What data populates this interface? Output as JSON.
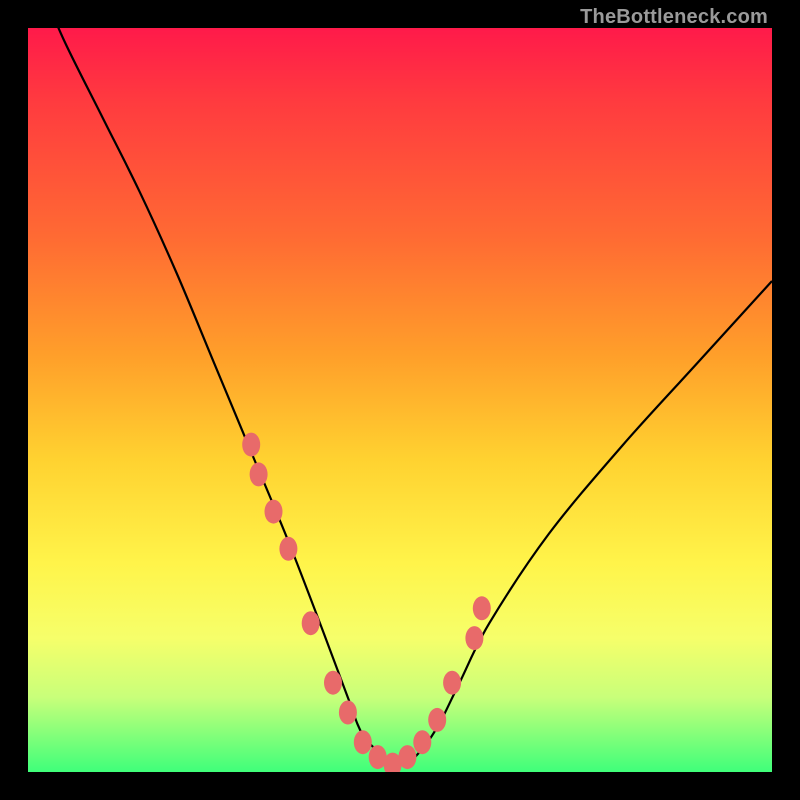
{
  "watermark": "TheBottleneck.com",
  "chart_data": {
    "type": "line",
    "title": "",
    "xlabel": "",
    "ylabel": "",
    "xlim": [
      0,
      100
    ],
    "ylim": [
      0,
      100
    ],
    "series": [
      {
        "name": "bottleneck-curve",
        "x": [
          2,
          5,
          10,
          15,
          20,
          25,
          30,
          35,
          40,
          43,
          45,
          48,
          50,
          52,
          55,
          58,
          62,
          70,
          80,
          90,
          100
        ],
        "values": [
          105,
          98,
          88,
          78,
          67,
          55,
          43,
          31,
          18,
          10,
          5,
          2,
          1,
          2,
          6,
          12,
          20,
          32,
          44,
          55,
          66
        ]
      }
    ],
    "points": {
      "name": "highlighted-points",
      "x": [
        30,
        31,
        33,
        35,
        38,
        41,
        43,
        45,
        47,
        49,
        51,
        53,
        55,
        57,
        60,
        61
      ],
      "values": [
        44,
        40,
        35,
        30,
        20,
        12,
        8,
        4,
        2,
        1,
        2,
        4,
        7,
        12,
        18,
        22
      ]
    },
    "colors": {
      "curve": "#000000",
      "points": "#e86a6a",
      "gradient_top": "#ff1a4a",
      "gradient_bottom": "#3fff7a"
    }
  }
}
